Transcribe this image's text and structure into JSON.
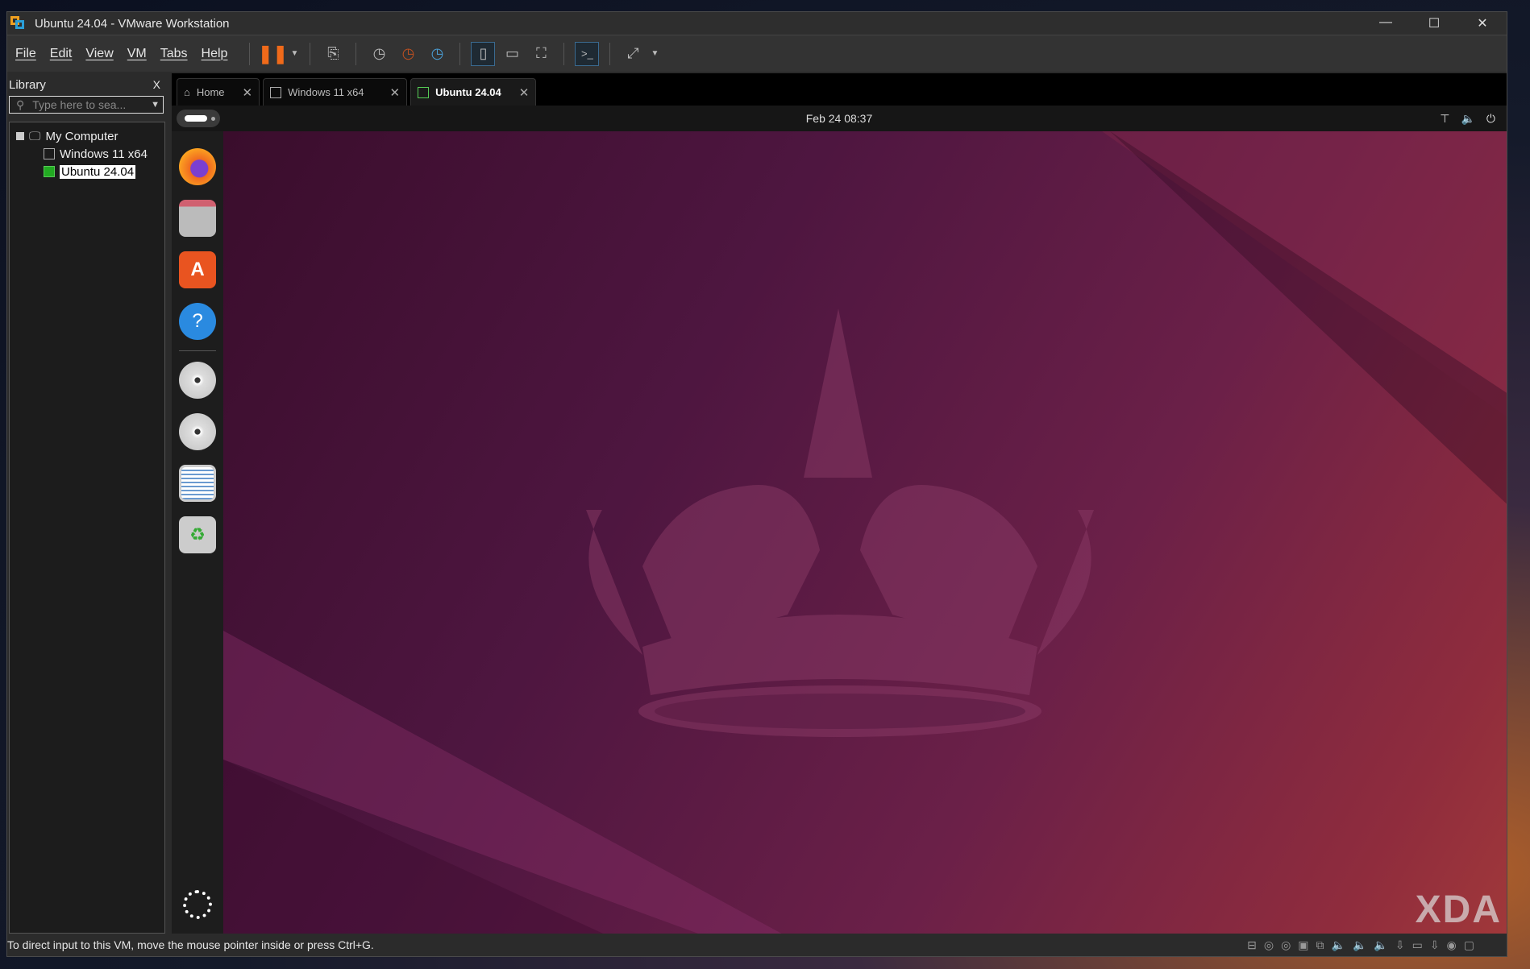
{
  "window": {
    "title": "Ubuntu 24.04 - VMware Workstation",
    "minimize": "—",
    "maximize": "☐",
    "close": "✕"
  },
  "menu": [
    "File",
    "Edit",
    "View",
    "VM",
    "Tabs",
    "Help"
  ],
  "library": {
    "title": "Library",
    "close": "X",
    "search_placeholder": "Type here to sea...",
    "tree": {
      "root": "My Computer",
      "items": [
        "Windows 11 x64",
        "Ubuntu 24.04"
      ]
    }
  },
  "tabs": [
    {
      "label": "Home"
    },
    {
      "label": "Windows 11 x64"
    },
    {
      "label": "Ubuntu 24.04",
      "active": true
    }
  ],
  "guest": {
    "clock": "Feb 24  08:37"
  },
  "dock": [
    "firefox",
    "files",
    "app-center",
    "help",
    "cd-drive",
    "cd-drive",
    "text-editor",
    "trash",
    "show-apps"
  ],
  "status": {
    "message": "To direct input to this VM, move the mouse pointer inside or press Ctrl+G."
  },
  "watermark": "XDA"
}
